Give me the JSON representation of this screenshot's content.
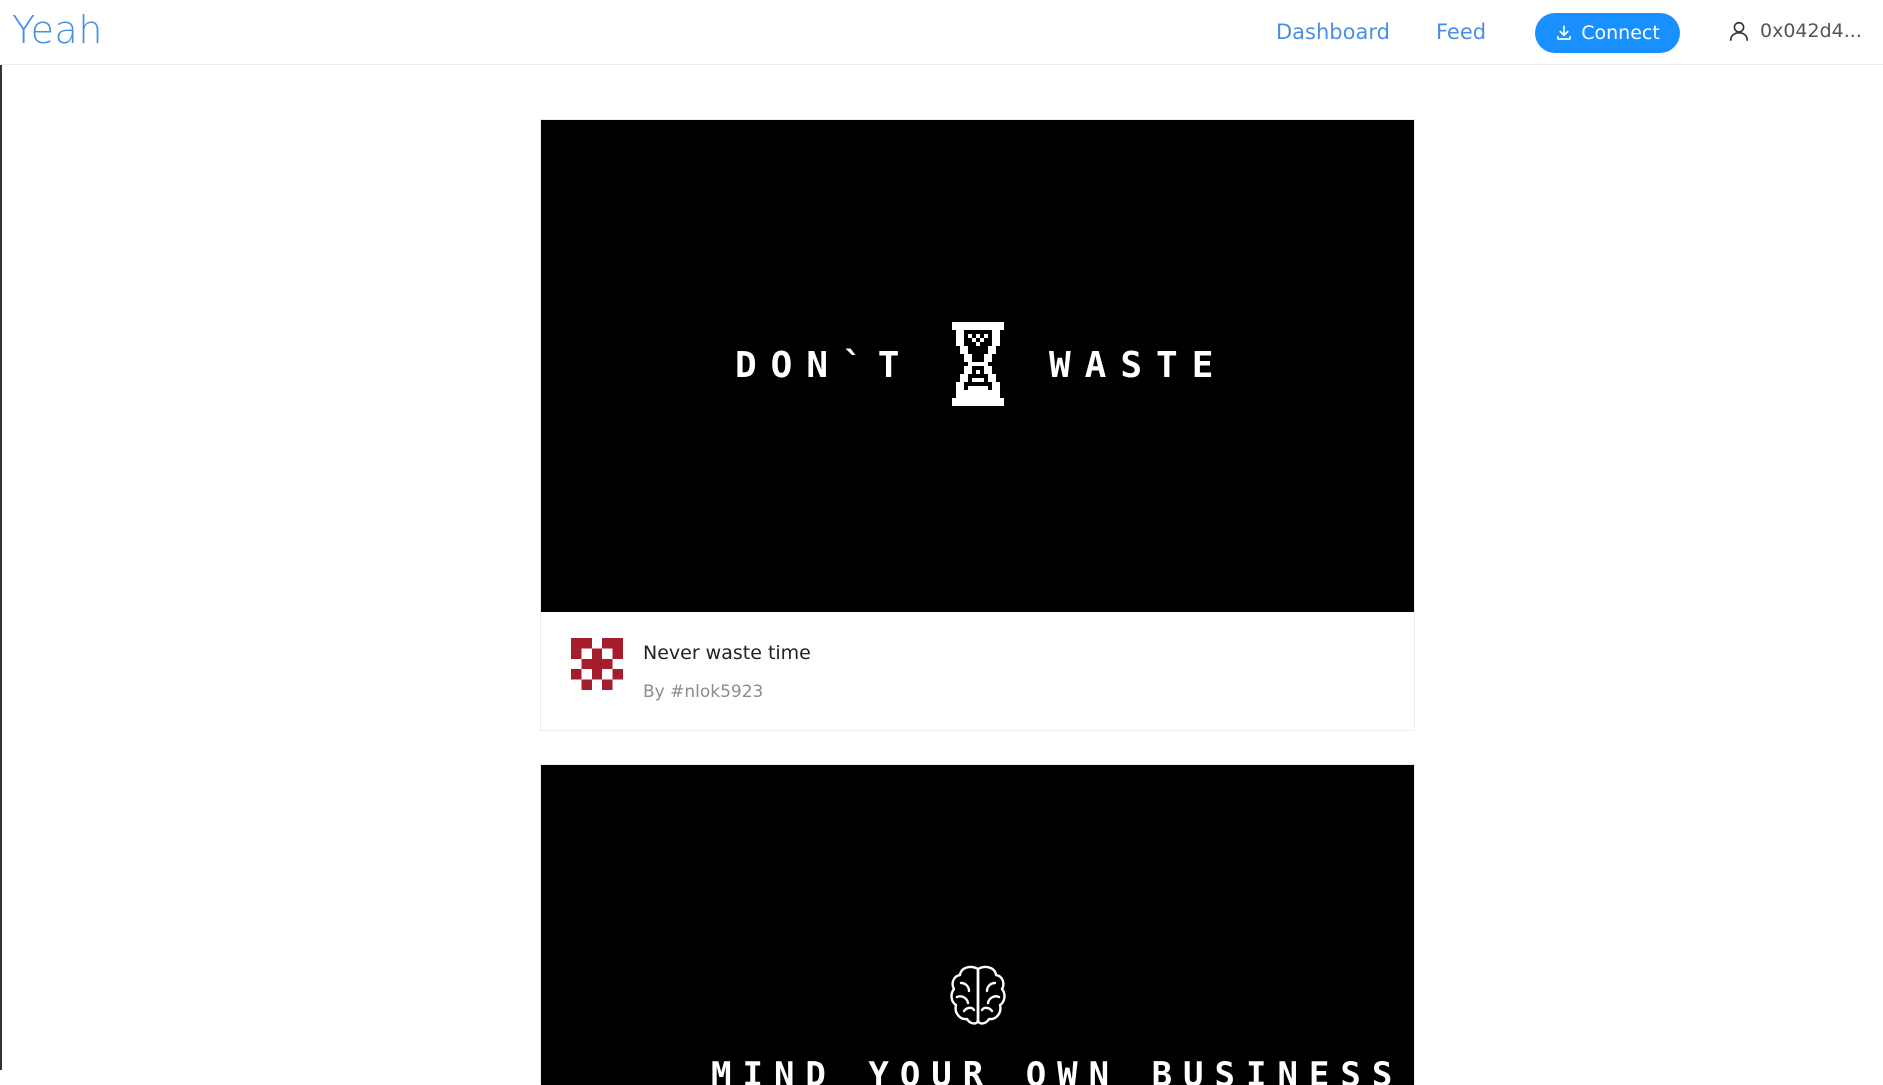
{
  "header": {
    "logo": "Yeah",
    "nav": [
      {
        "label": "Dashboard"
      },
      {
        "label": "Feed"
      }
    ],
    "connect_label": "Connect",
    "account_label": "0x042d4..."
  },
  "colors": {
    "accent": "#1890ff",
    "link": "#4a90e2",
    "avatar": "#a51d2d"
  },
  "feed": [
    {
      "title": "Never waste time",
      "author": "By #nlok5923",
      "image_text_left": "DON`T",
      "image_text_right": "WASTE",
      "image_icon": "hourglass-icon"
    },
    {
      "image_text": "MIND YOUR OWN BUSINESS",
      "image_icon": "brain-icon"
    }
  ]
}
